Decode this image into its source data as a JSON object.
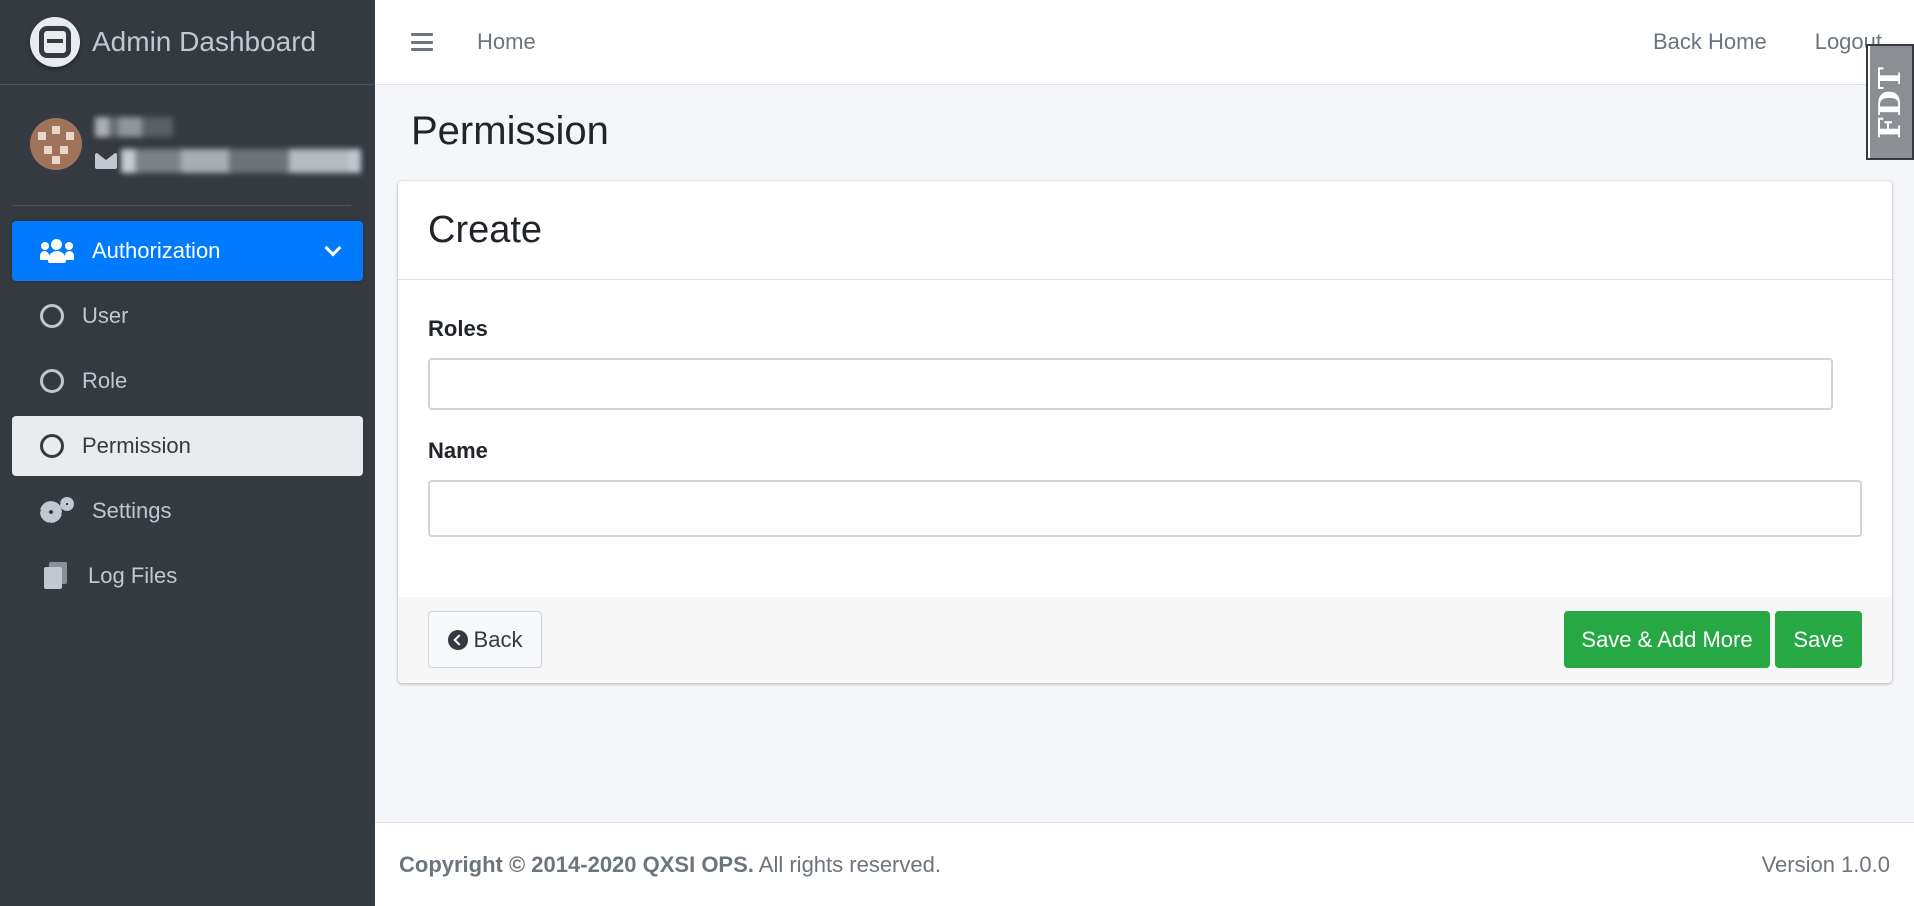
{
  "brand": {
    "title": "Admin Dashboard"
  },
  "user": {
    "name": "",
    "email": ""
  },
  "sidebar": {
    "items": [
      {
        "label": "Authorization",
        "icon": "users-icon",
        "state": "expanded"
      },
      {
        "label": "User",
        "icon": "circle-icon"
      },
      {
        "label": "Role",
        "icon": "circle-icon"
      },
      {
        "label": "Permission",
        "icon": "circle-icon",
        "state": "active"
      },
      {
        "label": "Settings",
        "icon": "gears-icon"
      },
      {
        "label": "Log Files",
        "icon": "files-icon"
      }
    ]
  },
  "topbar": {
    "home_label": "Home",
    "back_home_label": "Back Home",
    "logout_label": "Logout",
    "corner_badge": "FDT"
  },
  "page": {
    "title": "Permission"
  },
  "form": {
    "card_title": "Create",
    "roles_label": "Roles",
    "roles_value": "",
    "name_label": "Name",
    "name_value": "",
    "back_label": "Back",
    "save_add_more_label": "Save & Add More",
    "save_label": "Save"
  },
  "footer": {
    "copyright_bold": "Copyright © 2014-2020 QXSI OPS.",
    "copyright_rest": " All rights reserved.",
    "version": "Version 1.0.0"
  },
  "colors": {
    "sidebar_bg": "#343a40",
    "primary": "#007bff",
    "success": "#28a745",
    "content_bg": "#f4f6f9"
  }
}
